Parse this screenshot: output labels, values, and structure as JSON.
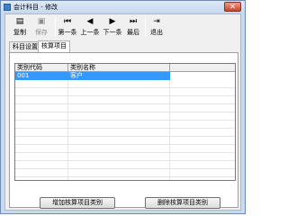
{
  "window": {
    "title": "会计科目 - 修改",
    "close_glyph": "✕"
  },
  "toolbar": {
    "buttons": [
      {
        "label": "复制",
        "icon": "copy-icon",
        "glyph": "▤",
        "enabled": true
      },
      {
        "label": "保存",
        "icon": "save-icon",
        "glyph": "▣",
        "enabled": false
      },
      {
        "label": "第一条",
        "icon": "first-record-icon",
        "glyph": "⏮",
        "enabled": true
      },
      {
        "label": "上一条",
        "icon": "previous-record-icon",
        "glyph": "◀",
        "enabled": true
      },
      {
        "label": "下一条",
        "icon": "next-record-icon",
        "glyph": "▶",
        "enabled": true
      },
      {
        "label": "最后",
        "icon": "last-record-icon",
        "glyph": "⏭",
        "enabled": true
      },
      {
        "label": "退出",
        "icon": "exit-icon",
        "glyph": "⇥",
        "enabled": true
      }
    ]
  },
  "tabs": [
    {
      "label": "科目设置",
      "active": false
    },
    {
      "label": "核算项目",
      "active": true
    }
  ],
  "grid": {
    "columns": [
      "类别代码",
      "类别名称"
    ],
    "rows": [
      {
        "code": "001",
        "name": "客户",
        "selected": true
      }
    ]
  },
  "actions": {
    "add_label": "增加核算项目类别",
    "delete_label": "删除核算项目类别"
  }
}
